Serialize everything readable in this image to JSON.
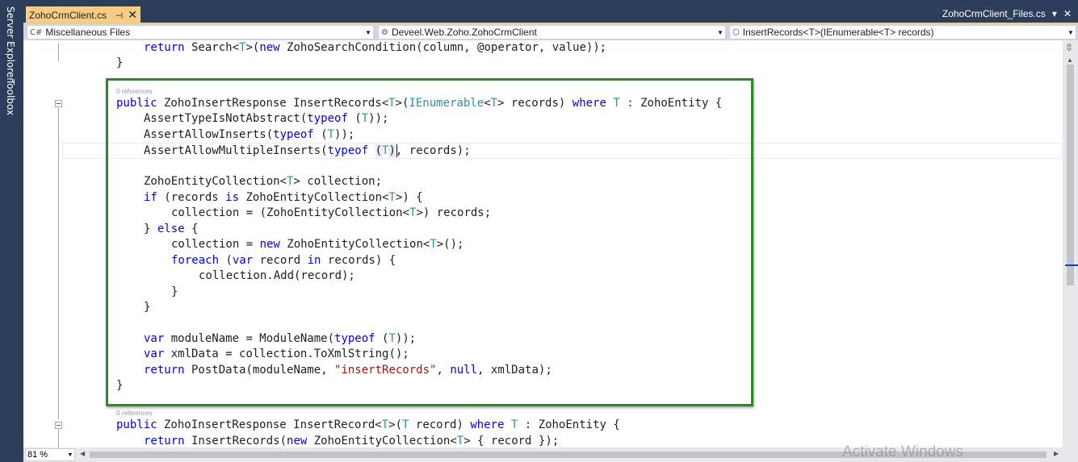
{
  "side_tabs": {
    "server_explorer": "Server Explorer",
    "toolbox": "Toolbox"
  },
  "tabs": {
    "active": {
      "title": "ZohoCrmClient.cs",
      "pin": "⊣",
      "close": "✕"
    },
    "other": {
      "title": "ZohoCrmClient_Files.cs"
    },
    "window_controls": {
      "dropdown": "▾",
      "close": "✕"
    }
  },
  "nav": {
    "project": "Miscellaneous Files",
    "type": "Deveel.Web.Zoho.ZohoCrmClient",
    "member": "InsertRecords<T>(IEnumerable<T> records)"
  },
  "code": {
    "l1": {
      "ret": "return",
      "a": " Search<",
      "t1": "T",
      "b": ">(",
      "nw": "new",
      "c": " ZohoSearchCondition(column, @operator, value));"
    },
    "l2": "}",
    "lens1": "0 references",
    "l3": {
      "pub": "public",
      "a": " ZohoInsertResponse InsertRecords<",
      "t1": "T",
      "b": ">(",
      "ie": "IEnumerable",
      "c": "<",
      "t2": "T",
      "d": "> records) ",
      "wh": "where",
      "e": " ",
      "t3": "T",
      "f": " : ZohoEntity {"
    },
    "l4": {
      "a": "AssertTypeIsNotAbstract(",
      "tf": "typeof",
      "b": " (",
      "t": "T",
      "c": "));"
    },
    "l5": {
      "a": "AssertAllowInserts(",
      "tf": "typeof",
      "b": " (",
      "t": "T",
      "c": "));"
    },
    "l6": {
      "a": "AssertAllowMultipleInserts(",
      "tf": "typeof",
      "b": " ",
      "p1": "(",
      "t": "T",
      "p2": ")",
      "c": ", records);"
    },
    "l7": {
      "a": "ZohoEntityCollection<",
      "t": "T",
      "b": "> collection;"
    },
    "l8": {
      "kw": "if",
      "a": " (records ",
      "is": "is",
      "b": " ZohoEntityCollection<",
      "t": "T",
      "c": ">) {"
    },
    "l9": {
      "a": "collection = (ZohoEntityCollection<",
      "t": "T",
      "b": ">) records;"
    },
    "l10": {
      "a": "} ",
      "el": "else",
      "b": " {"
    },
    "l11": {
      "a": "collection = ",
      "nw": "new",
      "b": " ZohoEntityCollection<",
      "t": "T",
      "c": ">();"
    },
    "l12": {
      "fe": "foreach",
      "a": " (",
      "vr": "var",
      "b": " record ",
      "in": "in",
      "c": " records) {"
    },
    "l13": "collection.Add(record);",
    "l14": "}",
    "l15": "}",
    "l16": {
      "vr": "var",
      "a": " moduleName = ModuleName(",
      "tf": "typeof",
      "b": " (",
      "t": "T",
      "c": "));"
    },
    "l17": {
      "vr": "var",
      "a": " xmlData = collection.ToXmlString();"
    },
    "l18": {
      "ret": "return",
      "a": " PostData(moduleName, ",
      "st": "\"insertRecords\"",
      "b": ", ",
      "nl": "null",
      "c": ", xmlData);"
    },
    "l19": "}",
    "lens2": "0 references",
    "l20": {
      "pub": "public",
      "a": " ZohoInsertResponse InsertRecord<",
      "t1": "T",
      "b": ">(",
      "t2": "T",
      "c": " record) ",
      "wh": "where",
      "d": " ",
      "t3": "T",
      "e": " : ZohoEntity {"
    },
    "l21": {
      "ret": "return",
      "a": " InsertRecords(",
      "nw": "new",
      "b": " ZohoEntityCollection<",
      "t": "T",
      "c": "> { record });"
    }
  },
  "zoom": "81 %",
  "watermark": "Activate Windows",
  "colors": {
    "keyword": "#0000ff",
    "type": "#2b91af",
    "string": "#a31515",
    "highlight_border": "#2a8a2a",
    "tab_active": "#f5cc84",
    "chrome": "#2d3e5c"
  }
}
